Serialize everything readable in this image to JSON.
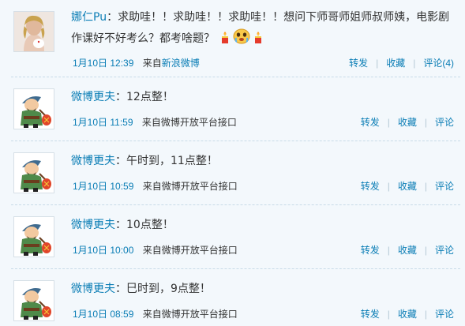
{
  "posts": [
    {
      "author": "娜仁Pu",
      "colon": "：",
      "text_line1": "求助哇！！求助哇！！求助哇！！想问下师哥师姐师叔师姨，电影剧",
      "text_line2": "作课好不好考么？都考啥题？",
      "time": "1月10日 12:39",
      "source_prefix": "来自",
      "source_name": "新浪微博",
      "repost": "转发",
      "favorite": "收藏",
      "comment": "评论(4)",
      "emoticons": [
        "candle-emoticon",
        "crying-face-emoticon",
        "candle-emoticon"
      ]
    },
    {
      "author": "微博更夫",
      "colon": "：",
      "text": "12点整！",
      "time": "1月10日 11:59",
      "source_prefix": "来自",
      "source_name": "微博开放平台接口",
      "repost": "转发",
      "favorite": "收藏",
      "comment": "评论"
    },
    {
      "author": "微博更夫",
      "colon": "：",
      "text": "午时到，11点整！",
      "time": "1月10日 10:59",
      "source_prefix": "来自",
      "source_name": "微博开放平台接口",
      "repost": "转发",
      "favorite": "收藏",
      "comment": "评论"
    },
    {
      "author": "微博更夫",
      "colon": "：",
      "text": "10点整！",
      "time": "1月10日 10:00",
      "source_prefix": "来自",
      "source_name": "微博开放平台接口",
      "repost": "转发",
      "favorite": "收藏",
      "comment": "评论"
    },
    {
      "author": "微博更夫",
      "colon": "：",
      "text": "巳时到，9点整！",
      "time": "1月10日 08:59",
      "source_prefix": "来自",
      "source_name": "微博开放平台接口",
      "repost": "转发",
      "favorite": "收藏",
      "comment": "评论"
    }
  ],
  "colors": {
    "link": "#0a7db5",
    "text": "#333333",
    "background": "#f3f8fc",
    "divider": "#c8dbe8"
  }
}
